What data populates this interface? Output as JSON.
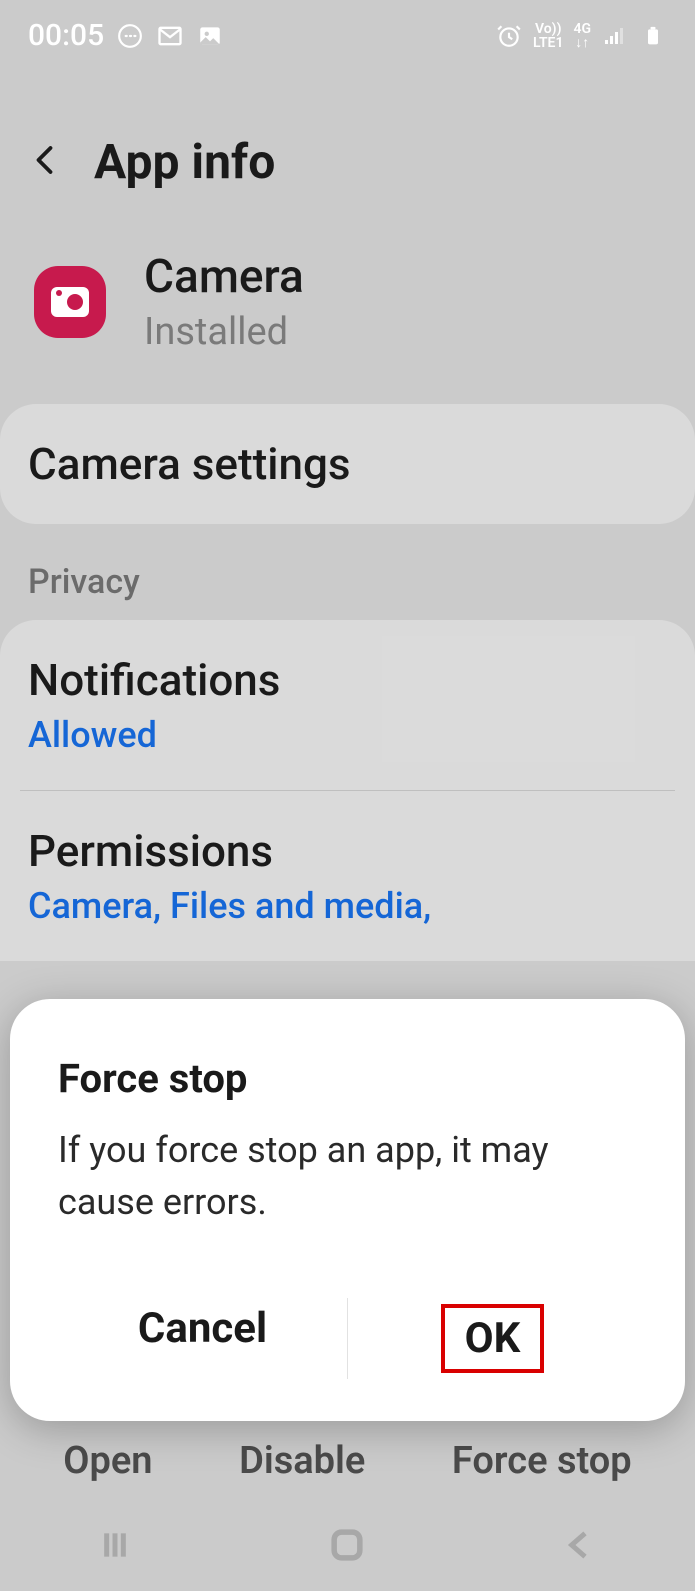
{
  "status_bar": {
    "time": "00:05",
    "lte_top": "Vo))",
    "lte_bottom": "LTE1",
    "net": "4G"
  },
  "header": {
    "title": "App info"
  },
  "app": {
    "name": "Camera",
    "status": "Installed"
  },
  "items": {
    "settings_link": "Camera settings",
    "privacy_label": "Privacy",
    "notifications": {
      "title": "Notifications",
      "value": "Allowed"
    },
    "permissions": {
      "title": "Permissions",
      "value": "Camera, Files and media,"
    }
  },
  "bottom_actions": {
    "open": "Open",
    "disable": "Disable",
    "force_stop": "Force stop"
  },
  "dialog": {
    "title": "Force stop",
    "message": "If you force stop an app, it may cause errors.",
    "cancel": "Cancel",
    "ok": "OK"
  }
}
